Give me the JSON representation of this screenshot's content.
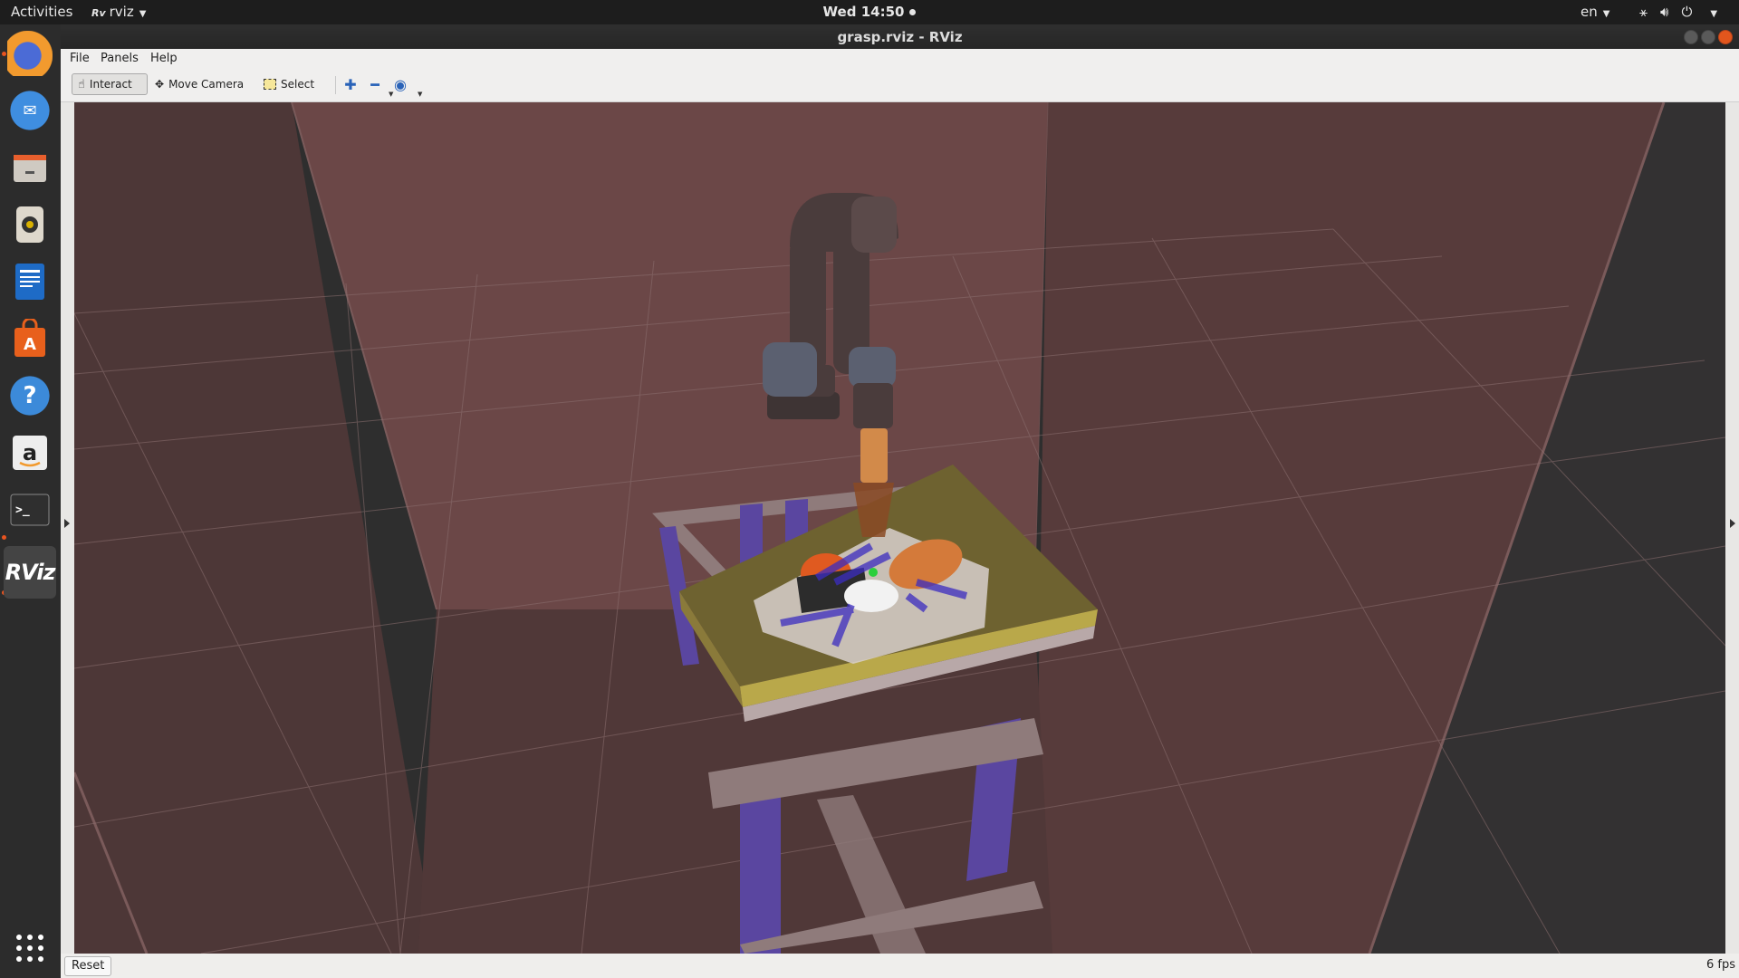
{
  "topbar": {
    "activities": "Activities",
    "app_menu": "rviz",
    "app_menu_icon": "rviz-icon",
    "clock": "Wed 14:50",
    "language": "en",
    "system_icons": [
      "network-icon",
      "volume-icon",
      "power-icon"
    ]
  },
  "dock": {
    "items": [
      {
        "name": "firefox",
        "icon": "firefox-icon",
        "running": true
      },
      {
        "name": "thunderbird",
        "icon": "mail-icon",
        "running": false
      },
      {
        "name": "files",
        "icon": "files-icon",
        "running": false
      },
      {
        "name": "rhythmbox",
        "icon": "music-icon",
        "running": false
      },
      {
        "name": "writer",
        "icon": "document-icon",
        "running": false
      },
      {
        "name": "software",
        "icon": "software-icon",
        "running": false
      },
      {
        "name": "help",
        "icon": "help-icon",
        "running": false
      },
      {
        "name": "amazon",
        "icon": "amazon-icon",
        "running": false
      },
      {
        "name": "terminal",
        "icon": "terminal-icon",
        "running": true
      },
      {
        "name": "rviz",
        "icon": "rviz-icon",
        "running": true
      }
    ],
    "show_apps_icon": "apps-grid-icon"
  },
  "window": {
    "title": "grasp.rviz - RViz",
    "menus": [
      "File",
      "Panels",
      "Help"
    ]
  },
  "toolbar": {
    "interact": "Interact",
    "move_camera": "Move Camera",
    "select": "Select",
    "icons": [
      "interact-hand-icon",
      "move-camera-icon",
      "select-icon",
      "add-tool-icon",
      "remove-tool-icon",
      "eye-view-icon"
    ]
  },
  "status": {
    "reset": "Reset",
    "fps": "6 fps"
  },
  "colors": {
    "wall": "#6b4747",
    "floor": "#4a3535",
    "table_top": "#6e6230",
    "table_edge": "#b9a84a",
    "leg": "#5a46a0",
    "frame": "#8f7b7b",
    "arm": "#4a3c3c",
    "joint_cap": "#5b6070",
    "gripper": "#d28a4a"
  }
}
